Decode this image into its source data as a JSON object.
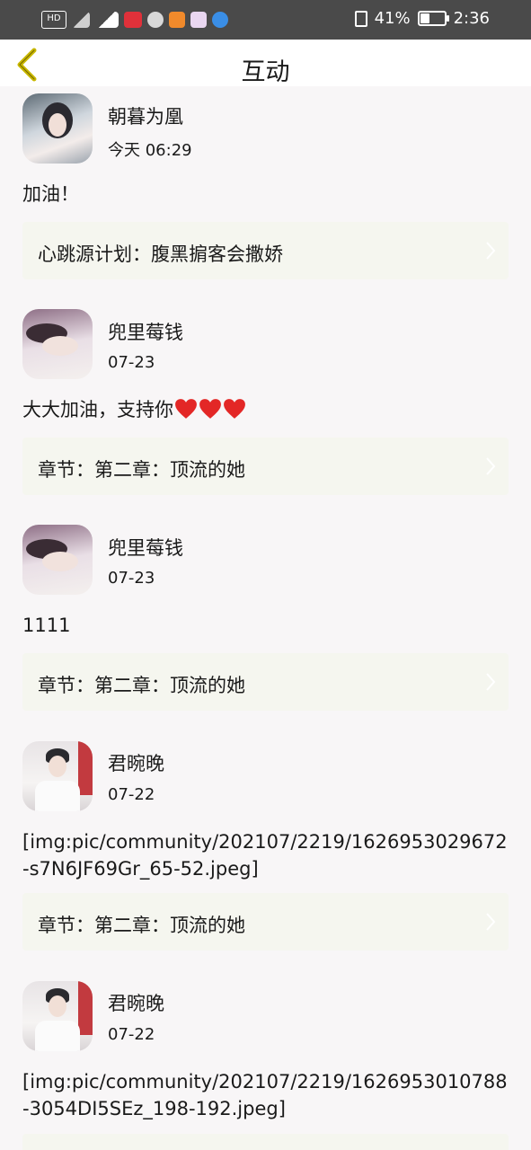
{
  "status_bar": {
    "battery_percent": "41%",
    "time": "2:36",
    "battery_level": 0.41
  },
  "header": {
    "title": "互动"
  },
  "posts": [
    {
      "user": "朝暮为凰",
      "date": "今天 06:29",
      "comment": "加油！",
      "reference": "心跳源计划：腹黑掮客会撒娇"
    },
    {
      "user": "兜里莓钱",
      "date": "07-23",
      "comment": "大大加油，支持你",
      "hearts": 3,
      "reference": "章节：第二章：顶流的她"
    },
    {
      "user": "兜里莓钱",
      "date": "07-23",
      "comment": "1111",
      "reference": "章节：第二章：顶流的她"
    },
    {
      "user": "君晼晚",
      "date": "07-22",
      "comment": "[img:pic/community/202107/2219/1626953029672-s7N6JF69Gr_65-52.jpeg]",
      "reference": "章节：第二章：顶流的她"
    },
    {
      "user": "君晼晚",
      "date": "07-22",
      "comment": "[img:pic/community/202107/2219/1626953010788-3054DI5SEz_198-192.jpeg]",
      "reference": ""
    }
  ],
  "colors": {
    "status_bar": "#4a4a4a",
    "back_arrow": "#c9b800",
    "reference_bg": "#f5f6ef",
    "heart": "#e32726"
  }
}
